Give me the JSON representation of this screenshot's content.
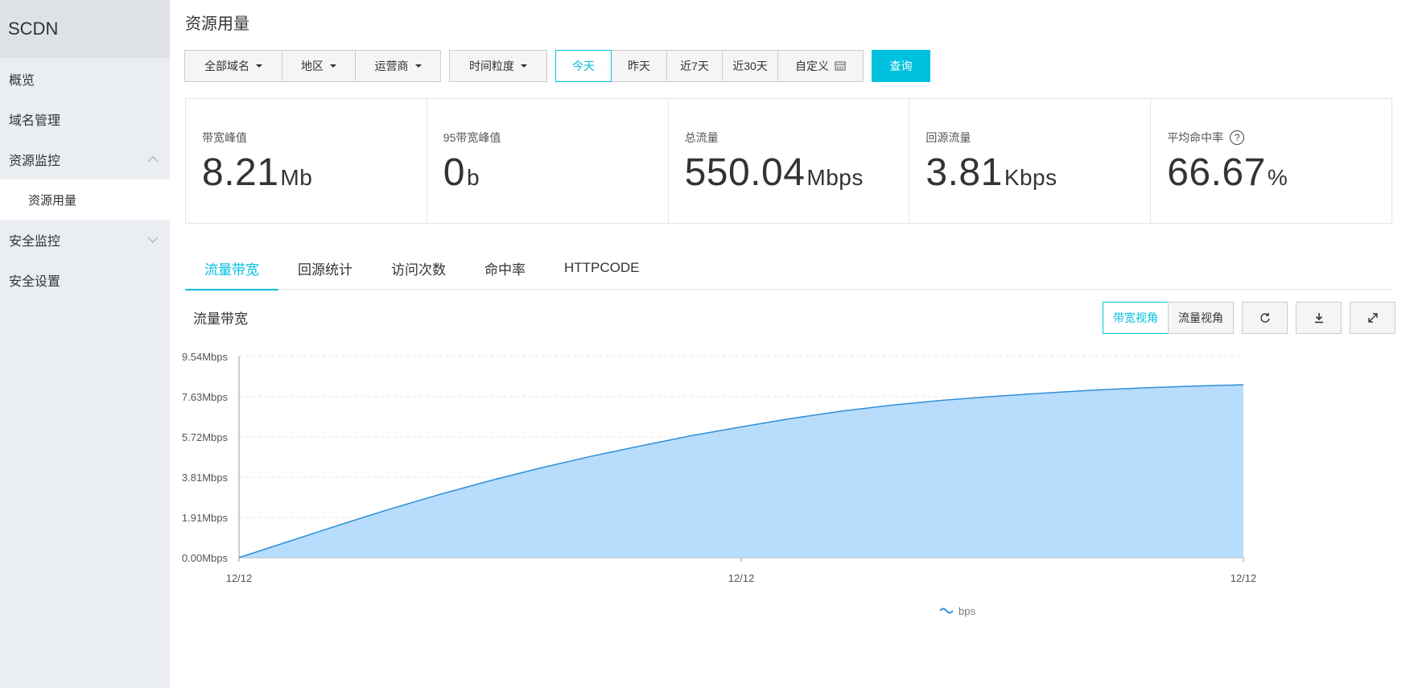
{
  "sidebar": {
    "brand": "SCDN",
    "items": [
      {
        "label": "概览"
      },
      {
        "label": "域名管理"
      },
      {
        "label": "资源监控"
      },
      {
        "label": "资源用量"
      },
      {
        "label": "安全监控"
      },
      {
        "label": "安全设置"
      }
    ]
  },
  "header": {
    "title": "资源用量"
  },
  "filters": {
    "domain": "全部域名",
    "region": "地区",
    "isp": "运营商",
    "granularity": "时间粒度",
    "ranges": [
      "今天",
      "昨天",
      "近7天",
      "近30天"
    ],
    "custom": "自定义",
    "query": "查询"
  },
  "stats": [
    {
      "label": "带宽峰值",
      "value": "8.21",
      "unit": "Mb"
    },
    {
      "label": "95带宽峰值",
      "value": "0",
      "unit": "b"
    },
    {
      "label": "总流量",
      "value": "550.04",
      "unit": "Mbps"
    },
    {
      "label": "回源流量",
      "value": "3.81",
      "unit": "Kbps"
    },
    {
      "label": "平均命中率",
      "value": "66.67",
      "unit": "%"
    }
  ],
  "tabs": [
    "流量带宽",
    "回源统计",
    "访问次数",
    "命中率",
    "HTTPCODE"
  ],
  "chart_panel": {
    "title": "流量带宽",
    "views": [
      "带宽视角",
      "流量视角"
    ],
    "icons": [
      "refresh-icon",
      "download-icon",
      "fullscreen-icon"
    ]
  },
  "colors": {
    "accent": "#00c1de",
    "area": "#b8dcfb",
    "line": "#2f8fd8"
  },
  "chart_data": {
    "type": "area",
    "x_ticks": [
      "12/12",
      "12/12",
      "12/12"
    ],
    "y_ticks": [
      "0.00Mbps",
      "1.91Mbps",
      "3.81Mbps",
      "5.72Mbps",
      "7.63Mbps",
      "9.54Mbps"
    ],
    "ylim": [
      0,
      9.54
    ],
    "series": [
      {
        "name": "bps",
        "x": [
          0,
          0.05,
          0.1,
          0.15,
          0.2,
          0.25,
          0.3,
          0.35,
          0.4,
          0.45,
          0.5,
          0.55,
          0.6,
          0.65,
          0.7,
          0.75,
          0.8,
          0.85,
          0.9,
          0.95,
          1.0
        ],
        "values": [
          0,
          0.78,
          1.55,
          2.3,
          3.0,
          3.65,
          4.25,
          4.8,
          5.3,
          5.78,
          6.2,
          6.6,
          6.95,
          7.23,
          7.46,
          7.64,
          7.8,
          7.94,
          8.05,
          8.13,
          8.2
        ]
      }
    ],
    "legend": "bottom",
    "grid": true
  }
}
